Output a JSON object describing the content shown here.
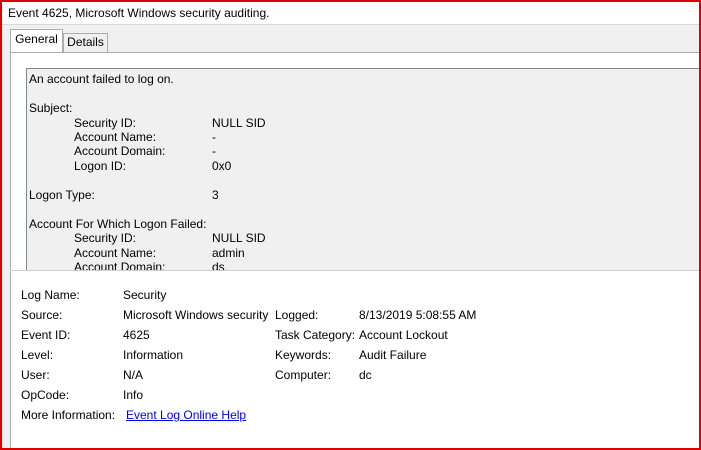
{
  "window": {
    "title": "Event 4625, Microsoft Windows security auditing."
  },
  "tabs": [
    {
      "label": "General",
      "active": true
    },
    {
      "label": "Details",
      "active": false
    }
  ],
  "description": {
    "summary": "An account failed to log on.",
    "subject_header": "Subject:",
    "subject": [
      {
        "label": "Security ID:",
        "value": "NULL SID"
      },
      {
        "label": "Account Name:",
        "value": "-"
      },
      {
        "label": "Account Domain:",
        "value": "-"
      },
      {
        "label": "Logon ID:",
        "value": "0x0"
      }
    ],
    "logon_type": {
      "label": "Logon Type:",
      "value": "3"
    },
    "failed_header": "Account For Which Logon Failed:",
    "failed_account": [
      {
        "label": "Security ID:",
        "value": "NULL SID"
      },
      {
        "label": "Account Name:",
        "value": "admin"
      },
      {
        "label": "Account Domain:",
        "value": "ds"
      }
    ]
  },
  "properties": {
    "log_name": {
      "label": "Log Name:",
      "value": "Security"
    },
    "source": {
      "label": "Source:",
      "value": "Microsoft Windows security"
    },
    "logged": {
      "label": "Logged:",
      "value": "8/13/2019 5:08:55 AM"
    },
    "event_id": {
      "label": "Event ID:",
      "value": "4625"
    },
    "task_category": {
      "label": "Task Category:",
      "value": "Account Lockout"
    },
    "level": {
      "label": "Level:",
      "value": "Information"
    },
    "keywords": {
      "label": "Keywords:",
      "value": "Audit Failure"
    },
    "user": {
      "label": "User:",
      "value": "N/A"
    },
    "computer": {
      "label": "Computer:",
      "value": "dc"
    },
    "opcode": {
      "label": "OpCode:",
      "value": "Info"
    },
    "more_info": {
      "label": "More Information:",
      "link": "Event Log Online Help"
    }
  },
  "colors": {
    "highlight_border": "#e00000",
    "link": "#0000ee"
  }
}
